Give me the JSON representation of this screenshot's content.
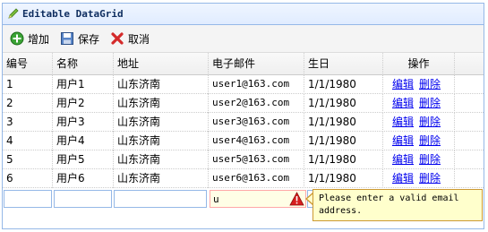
{
  "panel": {
    "title": "Editable DataGrid"
  },
  "toolbar": {
    "add_label": "增加",
    "save_label": "保存",
    "cancel_label": "取消"
  },
  "grid": {
    "columns": [
      "编号",
      "名称",
      "地址",
      "电子邮件",
      "生日",
      "操作"
    ],
    "rows": [
      {
        "id": "1",
        "name": "用户1",
        "address": "山东济南",
        "email": "user1@163.com",
        "birthday": "1/1/1980",
        "edit": "编辑",
        "delete": "删除"
      },
      {
        "id": "2",
        "name": "用户2",
        "address": "山东济南",
        "email": "user2@163.com",
        "birthday": "1/1/1980",
        "edit": "编辑",
        "delete": "删除"
      },
      {
        "id": "3",
        "name": "用户3",
        "address": "山东济南",
        "email": "user3@163.com",
        "birthday": "1/1/1980",
        "edit": "编辑",
        "delete": "删除"
      },
      {
        "id": "4",
        "name": "用户4",
        "address": "山东济南",
        "email": "user4@163.com",
        "birthday": "1/1/1980",
        "edit": "编辑",
        "delete": "删除"
      },
      {
        "id": "5",
        "name": "用户5",
        "address": "山东济南",
        "email": "user5@163.com",
        "birthday": "1/1/1980",
        "edit": "编辑",
        "delete": "删除"
      },
      {
        "id": "6",
        "name": "用户6",
        "address": "山东济南",
        "email": "user6@163.com",
        "birthday": "1/1/1980",
        "edit": "编辑",
        "delete": "删除"
      }
    ],
    "editing_row": {
      "id": "",
      "name": "",
      "address": "",
      "email": "u",
      "birthday": ""
    }
  },
  "validation": {
    "message": "Please enter a valid email address."
  },
  "icons": {
    "title": "pencil-icon",
    "add": "add-icon",
    "save": "save-icon",
    "cancel": "cancel-icon",
    "warning": "warning-icon"
  },
  "colors": {
    "border": "#95b8e7",
    "title_text": "#0e2d5f",
    "link": "#0000ee",
    "tooltip_bg": "#ffffcc",
    "invalid_bg": "#fffee6"
  }
}
